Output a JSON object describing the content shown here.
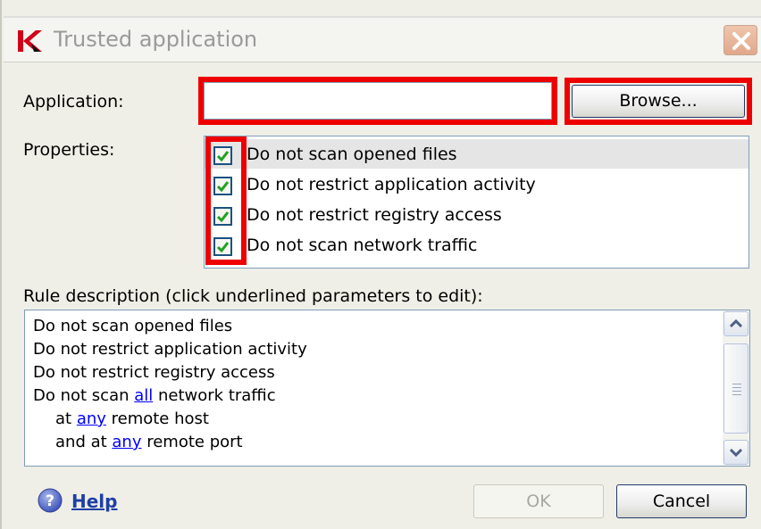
{
  "window": {
    "title": "Trusted application",
    "logo": "kaspersky-k-logo",
    "close_icon": "close-x-icon"
  },
  "application": {
    "label": "Application:",
    "value": "",
    "browse_label": "Browse..."
  },
  "properties": {
    "label": "Properties:",
    "items": [
      {
        "label": "Do not scan opened files",
        "checked": true,
        "selected": true
      },
      {
        "label": "Do not restrict application activity",
        "checked": true,
        "selected": false
      },
      {
        "label": "Do not restrict registry access",
        "checked": true,
        "selected": false
      },
      {
        "label": "Do not scan network traffic",
        "checked": true,
        "selected": false
      }
    ]
  },
  "rule_description": {
    "label": "Rule description (click underlined parameters to edit):",
    "lines": {
      "l1": "Do not scan opened files",
      "l2": "Do not restrict application activity",
      "l3": "Do not restrict registry access",
      "l4_pre": "Do not scan ",
      "l4_link": "all",
      "l4_post": " network traffic",
      "l5_pre": "at ",
      "l5_link": "any",
      "l5_post": " remote host",
      "l6_pre": "and at ",
      "l6_link": "any",
      "l6_post": " remote port"
    }
  },
  "footer": {
    "help_label": "Help",
    "ok_label": "OK",
    "cancel_label": "Cancel"
  },
  "colors": {
    "highlight": "#ee0000",
    "link": "#0000ff",
    "checkmark": "#21a121"
  }
}
